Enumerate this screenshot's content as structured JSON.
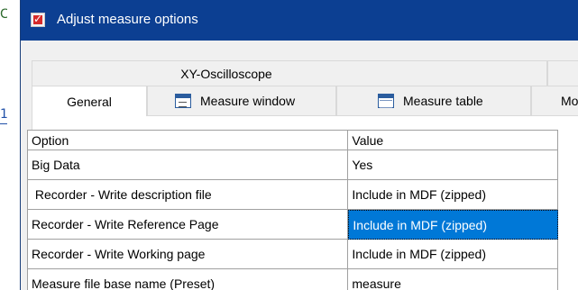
{
  "dialog": {
    "title": "Adjust measure options"
  },
  "tabs_row1": [
    {
      "label": "XY-Oscilloscope"
    }
  ],
  "tabs_row2": [
    {
      "label": "General",
      "active": true
    },
    {
      "label": "Measure window",
      "icon": "measure-window-icon"
    },
    {
      "label": "Measure table",
      "icon": "measure-table-icon"
    },
    {
      "label": "Mo"
    }
  ],
  "grid": {
    "headers": {
      "option": "Option",
      "value": "Value"
    },
    "rows": [
      {
        "option": "Big Data",
        "value": "Yes"
      },
      {
        "option": " Recorder - Write description file",
        "value": "Include in MDF (zipped)"
      },
      {
        "option": "Recorder - Write Reference Page",
        "value": "Include in MDF (zipped)",
        "selected": true
      },
      {
        "option": "Recorder - Write Working page",
        "value": "Include in MDF (zipped)"
      },
      {
        "option": "Measure file base name (Preset)",
        "value": "measure"
      }
    ]
  },
  "background": {
    "glyph_top": "C",
    "glyph_mid": "1"
  },
  "colors": {
    "titlebar": "#0c3f92",
    "selection": "#0078d7"
  }
}
